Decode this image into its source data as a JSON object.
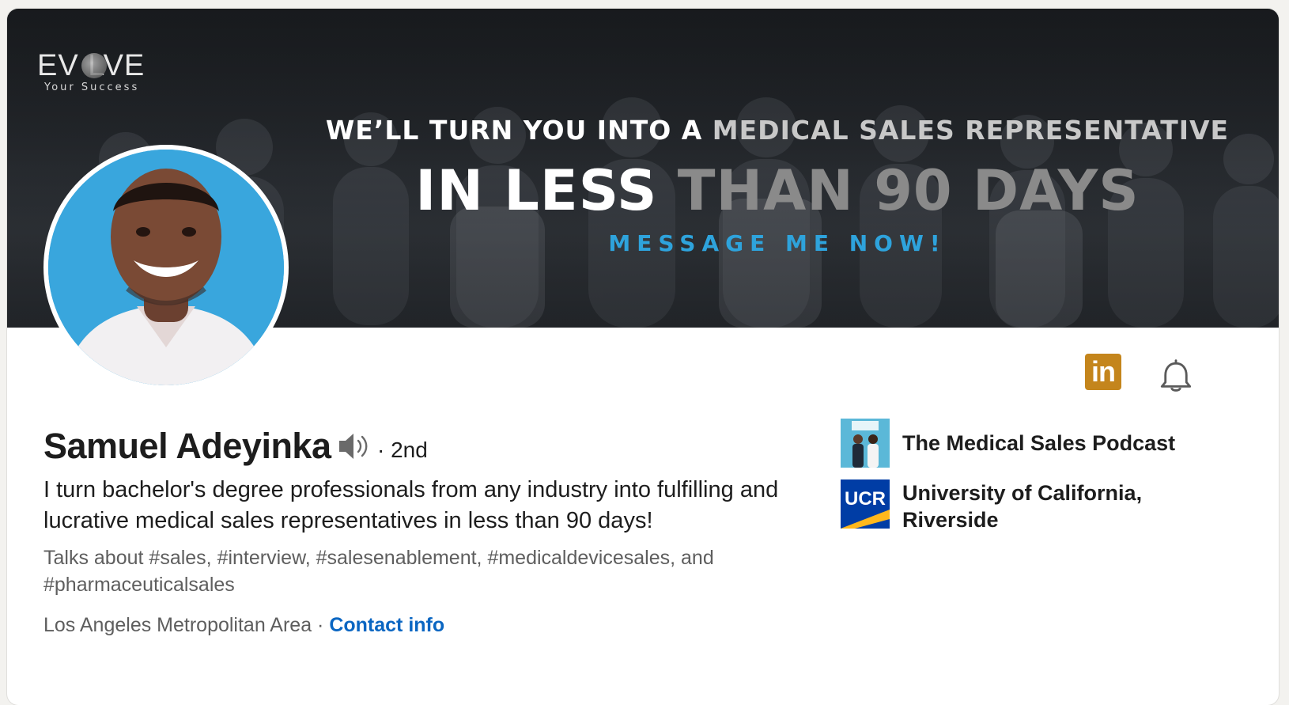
{
  "banner": {
    "brand": "EV   LVE",
    "brand_sub": "Your Success",
    "tagline_1_a": "WE’LL TURN YOU INTO A ",
    "tagline_1_b": "MEDICAL SALES REPRESENTATIVE",
    "tagline_2_a": "IN  LESS ",
    "tagline_2_b": "THAN 90 DAYS",
    "tagline_3": "MESSAGE  ME  NOW!"
  },
  "profile": {
    "name": "Samuel Adeyinka",
    "degree": "· 2nd",
    "headline": "I turn bachelor's degree professionals from any industry into fulfilling and lucrative medical sales representatives in less than 90 days!",
    "talks_about": "Talks about #sales, #interview, #salesenablement, #medicaldevicesales, and #pharmaceuticalsales",
    "location": "Los Angeles Metropolitan Area · ",
    "contact_info": "Contact info"
  },
  "actions": {
    "linkedin_glyph": "in"
  },
  "organizations": [
    {
      "name": "The Medical Sales Podcast",
      "logo_icon": "podcast-logo-icon"
    },
    {
      "name": "University of California, Riverside",
      "logo_text": "UCR",
      "logo_icon": "ucr-logo-icon"
    }
  ],
  "colors": {
    "link": "#0a66c2",
    "avatar_bg": "#39a6dd",
    "linkedin_badge": "#c4851c",
    "banner_accent": "#2ea3dc"
  }
}
